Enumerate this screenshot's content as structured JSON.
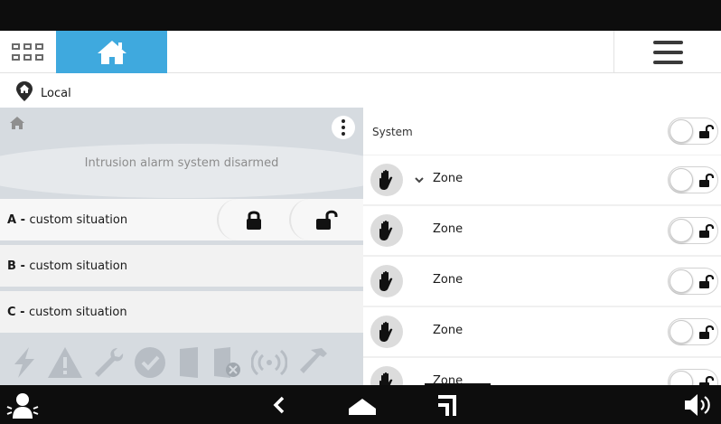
{
  "location": {
    "label": "Local"
  },
  "alarm_panel": {
    "status_text": "Intrusion alarm system disarmed",
    "situations": [
      {
        "letter": "A",
        "sep": " - ",
        "label": "custom situation"
      },
      {
        "letter": "B",
        "sep": " - ",
        "label": "custom situation"
      },
      {
        "letter": "C",
        "sep": " - ",
        "label": "custom situation"
      }
    ],
    "fault_icons": [
      "lightning-icon",
      "warning-icon",
      "wrench-icon",
      "check-circle-icon",
      "door-icon",
      "door-disabled-icon",
      "signal-icon",
      "hammer-icon"
    ]
  },
  "zones_panel": {
    "system_label": "System",
    "zones": [
      {
        "label": "Zone",
        "expandable": true
      },
      {
        "label": "Zone",
        "expandable": false
      },
      {
        "label": "Zone",
        "expandable": false
      },
      {
        "label": "Zone",
        "expandable": false
      },
      {
        "label": "Zone",
        "expandable": false
      }
    ]
  },
  "colors": {
    "accent": "#3fa9de",
    "panel_bg": "#d6dbe0",
    "bar_bg": "#0d0d0d"
  }
}
